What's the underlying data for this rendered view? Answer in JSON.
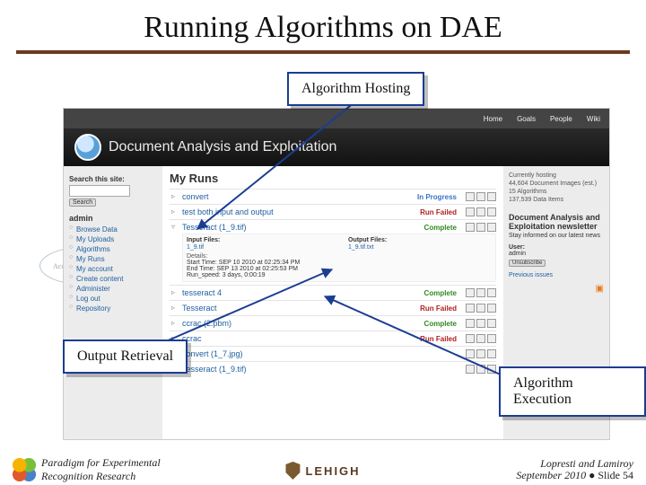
{
  "title": "Running Algorithms on DAE",
  "bg_bubble": "Access to refe data repos",
  "callouts": {
    "hosting": "Algorithm Hosting",
    "output": "Output Retrieval",
    "execution": "Algorithm Execution"
  },
  "webapp": {
    "topnav": [
      "Home",
      "Goals",
      "People",
      "Wiki"
    ],
    "banner_title": "Document Analysis and Exploitation",
    "sidebar": {
      "search_label": "Search this site:",
      "search_button": "Search",
      "section": "admin",
      "items": [
        "Browse Data",
        "My Uploads",
        "Algorithms",
        "My Runs",
        "My account",
        "Create content",
        "Administer",
        "Log out",
        "Repository"
      ]
    },
    "main": {
      "heading": "My Runs",
      "runs": [
        {
          "name": "convert",
          "status": "In Progress"
        },
        {
          "name": "test both input and output",
          "status": "Run Failed"
        },
        {
          "name": "Tesseract (1_9.tif)",
          "status": "Complete"
        },
        {
          "name": "tesseract 4",
          "status": "Complete"
        },
        {
          "name": "Tesseract",
          "status": "Run Failed"
        },
        {
          "name": "ccrac (2.pbm)",
          "status": "Complete"
        },
        {
          "name": "ccrac",
          "status": "Run Failed"
        },
        {
          "name": "convert (1_7.jpg)",
          "status": ""
        },
        {
          "name": "Tesseract (1_9.tif)",
          "status": ""
        }
      ],
      "expanded": {
        "input_header": "Input Files:",
        "output_header": "Output Files:",
        "input_file": "1_9.tif",
        "output_file": "1_9.tif.txt",
        "details_label": "Details:",
        "start": "Start Time:   SEP 10 2010 at 02:25:34 PM",
        "end": "End Time:   SEP 13 2010 at 02:25:53 PM",
        "dur": "Run_speed:   3 days, 0:00:19"
      }
    },
    "right": {
      "stats": [
        "Currently hosting",
        "44,604 Document Images (est.)",
        "15 Algorithms",
        "137,539 Data Items"
      ],
      "newsletter_heading": "Document Analysis and Exploitation newsletter",
      "newsletter_blurb": "Stay informed on our latest news",
      "user_label": "User:",
      "user": "admin",
      "unsubscribe": "Unsubscribe",
      "prev_issues": "Previous issues"
    }
  },
  "footer": {
    "left_line1": "Paradigm for Experimental",
    "left_line2": "Recognition Research",
    "lehigh": "LEHIGH",
    "authors": "Lopresti and Lamiroy",
    "date": "September 2010",
    "slide": "Slide 54"
  }
}
